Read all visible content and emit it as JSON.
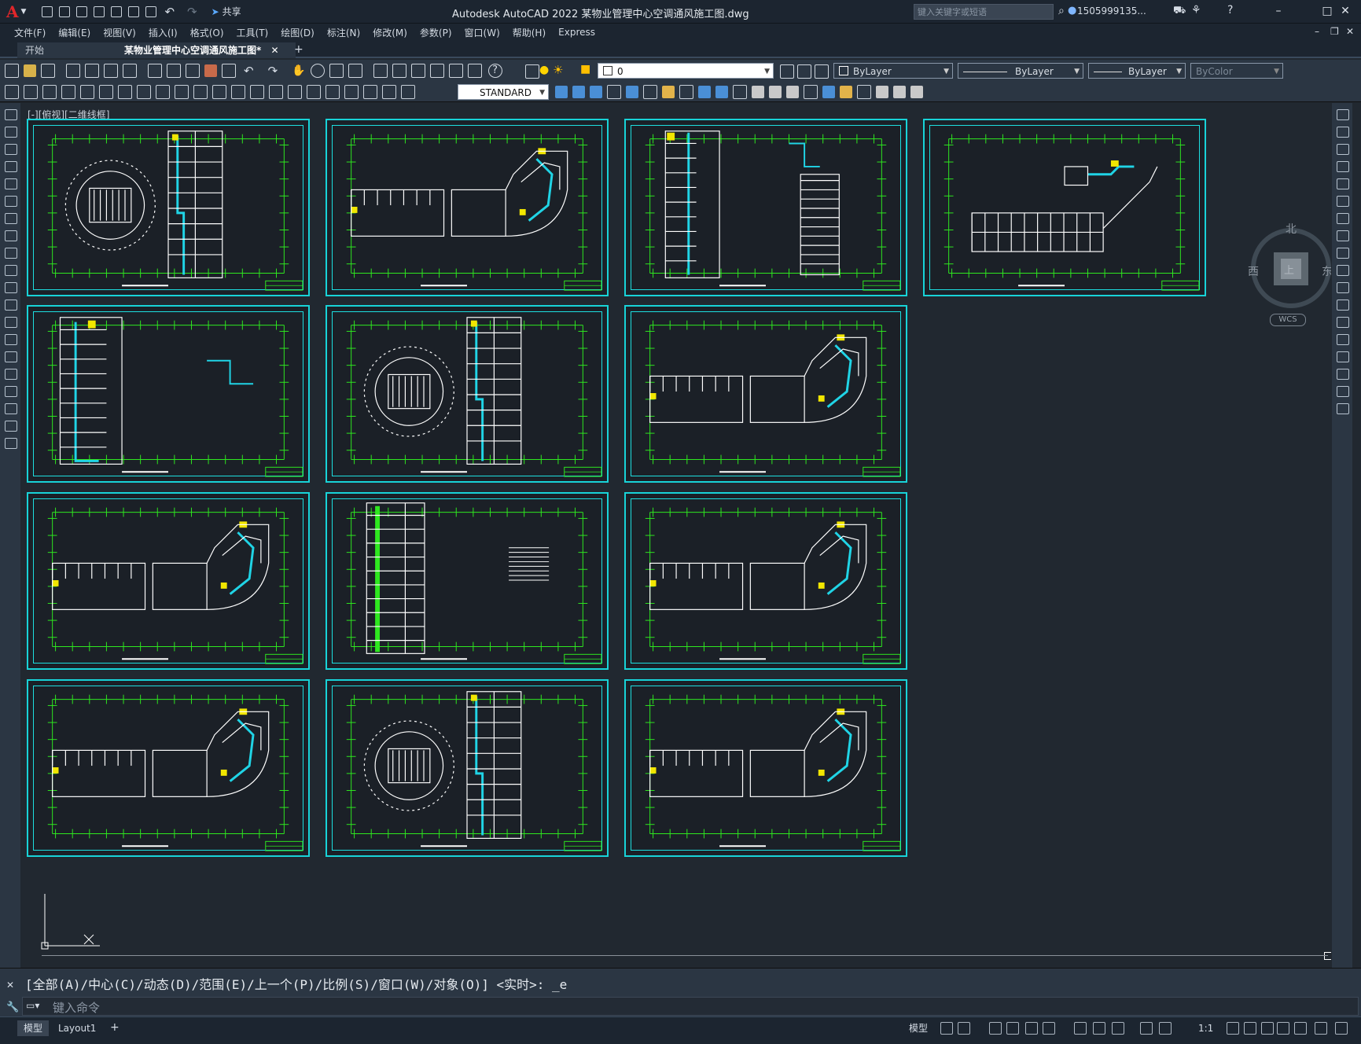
{
  "app": {
    "logo": "A",
    "window_title": "Autodesk AutoCAD 2022    某物业管理中心空调通风施工图.dwg",
    "search_placeholder": "键入关键字或短语",
    "user": "1505999135...",
    "share_label": "共享"
  },
  "menu": [
    "文件(F)",
    "编辑(E)",
    "视图(V)",
    "插入(I)",
    "格式(O)",
    "工具(T)",
    "绘图(D)",
    "标注(N)",
    "修改(M)",
    "参数(P)",
    "窗口(W)",
    "帮助(H)",
    "Express"
  ],
  "tabs": {
    "start": "开始",
    "active": "某物业管理中心空调通风施工图*"
  },
  "toolbar": {
    "layer_value": "0",
    "color_value": "ByLayer",
    "linetype_value": "ByLayer",
    "lineweight_value": "ByLayer",
    "plotstyle_value": "ByColor",
    "text_style": "STANDARD"
  },
  "canvas": {
    "view_label": "[-][俯视][二维线框]",
    "compass": {
      "north": "北",
      "east": "东",
      "west": "西",
      "top_label": "上",
      "wcs": "WCS"
    }
  },
  "command": {
    "history": "[全部(A)/中心(C)/动态(D)/范围(E)/上一个(P)/比例(S)/窗口(W)/对象(O)] <实时>: _e",
    "placeholder": "键入命令"
  },
  "status": {
    "model_tab": "模型",
    "layout_tab": "Layout1",
    "model_button": "模型",
    "scale": "1:1"
  },
  "colors": {
    "sheet_border": "#18d3d8",
    "plan_lines": "#ffffff",
    "grid_lines": "#2ee81f",
    "duct": "#20d4e6",
    "highlight": "#f2e600",
    "accent": "#e0262a"
  }
}
